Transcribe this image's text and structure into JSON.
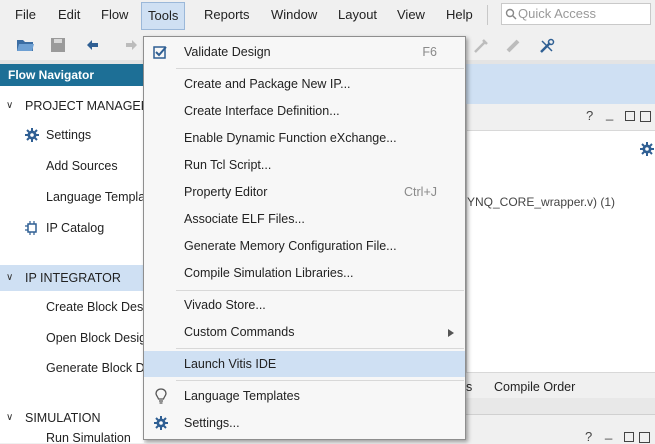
{
  "menubar": {
    "items": [
      "File",
      "Edit",
      "Flow",
      "Tools",
      "Reports",
      "Window",
      "Layout",
      "View",
      "Help"
    ],
    "active": "Tools",
    "quick_access_placeholder": "Quick Access"
  },
  "toolbar": {
    "icons": [
      "open-folder-icon",
      "save-icon",
      "undo-icon",
      "redo-icon",
      "disabled-tool-icon",
      "disabled-tool-icon",
      "settings-tool-icon"
    ]
  },
  "flow_navigator": {
    "title": "Flow Navigator",
    "sections": [
      {
        "label": "PROJECT MANAGER",
        "items": [
          "Settings",
          "Add Sources",
          "Language Templa",
          "IP Catalog"
        ]
      },
      {
        "label": "IP INTEGRATOR",
        "items": [
          "Create Block Desi",
          "Open Block Desig",
          "Generate Block D"
        ]
      },
      {
        "label": "SIMULATION",
        "items": [
          "Run Simulation"
        ]
      }
    ]
  },
  "right_panel": {
    "fragment_text": "YNQ_CORE_wrapper.v) (1)",
    "tabs": [
      "s",
      "Compile Order"
    ]
  },
  "tools_menu": {
    "items": [
      {
        "label": "Validate Design",
        "shortcut": "F6",
        "icon": "validate-check-icon"
      },
      {
        "label": "Create and Package New IP..."
      },
      {
        "label": "Create Interface Definition..."
      },
      {
        "label": "Enable Dynamic Function eXchange..."
      },
      {
        "label": "Run Tcl Script..."
      },
      {
        "label": "Property Editor",
        "shortcut": "Ctrl+J"
      },
      {
        "label": "Associate ELF Files..."
      },
      {
        "label": "Generate Memory Configuration File..."
      },
      {
        "label": "Compile Simulation Libraries..."
      },
      {
        "label": "Vivado Store..."
      },
      {
        "label": "Custom Commands",
        "submenu": true
      },
      {
        "label": "Launch Vitis IDE",
        "highlighted": true
      },
      {
        "label": "Language Templates",
        "icon": "lightbulb-icon"
      },
      {
        "label": "Settings...",
        "icon": "gear-icon"
      }
    ]
  },
  "colors": {
    "accent_header": "#1d6f96",
    "selection": "#cfe0f3",
    "menu_bg": "#f7f7f7"
  }
}
